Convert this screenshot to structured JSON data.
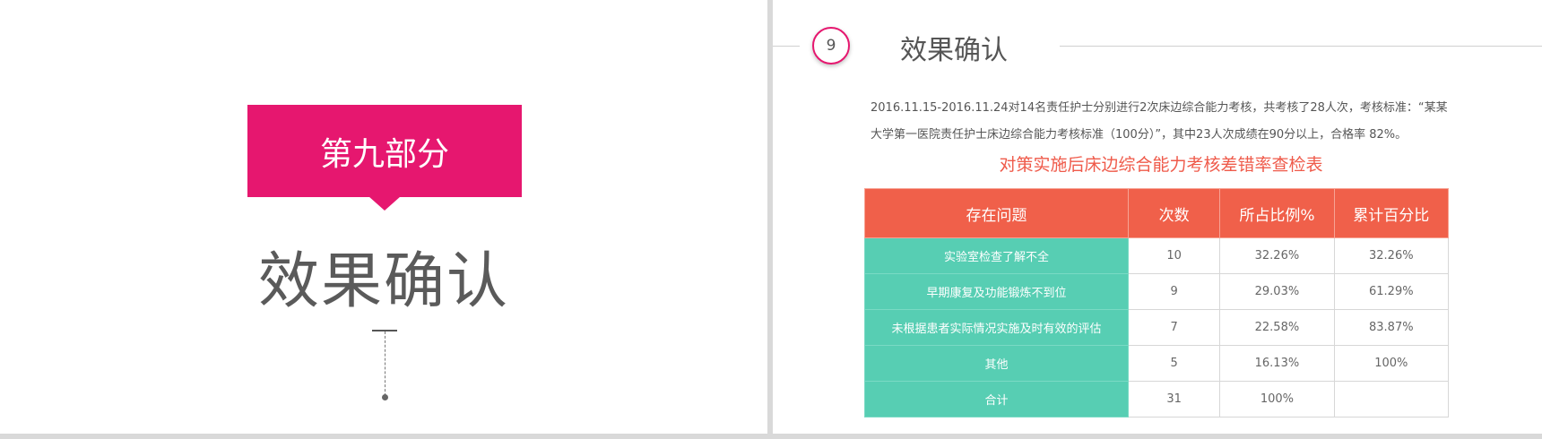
{
  "left_slide": {
    "section_tag": "第九部分",
    "title": "效果确认"
  },
  "right_slide": {
    "number": "9",
    "title": "效果确认",
    "intro": "2016.11.15-2016.11.24对14名责任护士分别进行2次床边综合能力考核，共考核了28人次，考核标准：“某某大学第一医院责任护士床边综合能力考核标准（100分）”，其中23人次成绩在90分以上，合格率 82%。",
    "table_title": "对策实施后床边综合能力考核差错率查检表",
    "table": {
      "headers": [
        "存在问题",
        "次数",
        "所占比例%",
        "累计百分比"
      ],
      "rows": [
        [
          "实验室检查了解不全",
          "10",
          "32.26%",
          "32.26%"
        ],
        [
          "早期康复及功能锻炼不到位",
          "9",
          "29.03%",
          "61.29%"
        ],
        [
          "未根据患者实际情况实施及时有效的评估",
          "7",
          "22.58%",
          "83.87%"
        ],
        [
          "其他",
          "5",
          "16.13%",
          "100%"
        ],
        [
          "合计",
          "31",
          "100%",
          ""
        ]
      ]
    }
  },
  "colors": {
    "accent_pink": "#e6176f",
    "header_red": "#f0604a",
    "teal": "#57ceb3",
    "title_red": "#ef5a4a"
  }
}
